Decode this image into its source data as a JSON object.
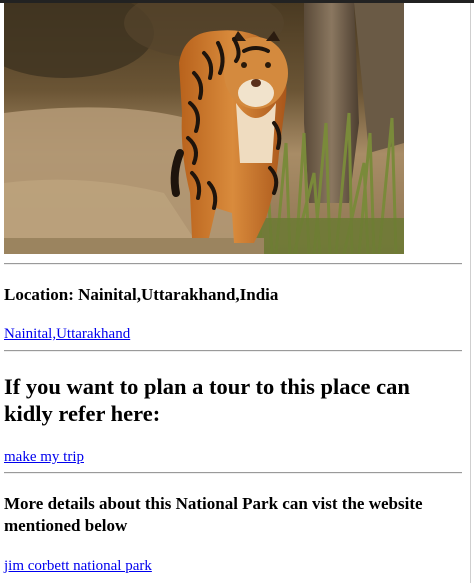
{
  "photo": {
    "subject": "tiger-photo"
  },
  "location": {
    "heading": "Location: Nainital,Uttarakhand,India",
    "link_text": "Nainital,Uttarakhand"
  },
  "tour": {
    "heading": "If you want to plan a tour to this place can kidly refer here:",
    "link_text": "make my trip"
  },
  "details": {
    "heading": "More details about this National Park can vist the website mentioned below",
    "link_text": "jim corbett national park"
  },
  "colors": {
    "link": "#0000ee",
    "text": "#000000",
    "rule": "#9a9a9a"
  }
}
